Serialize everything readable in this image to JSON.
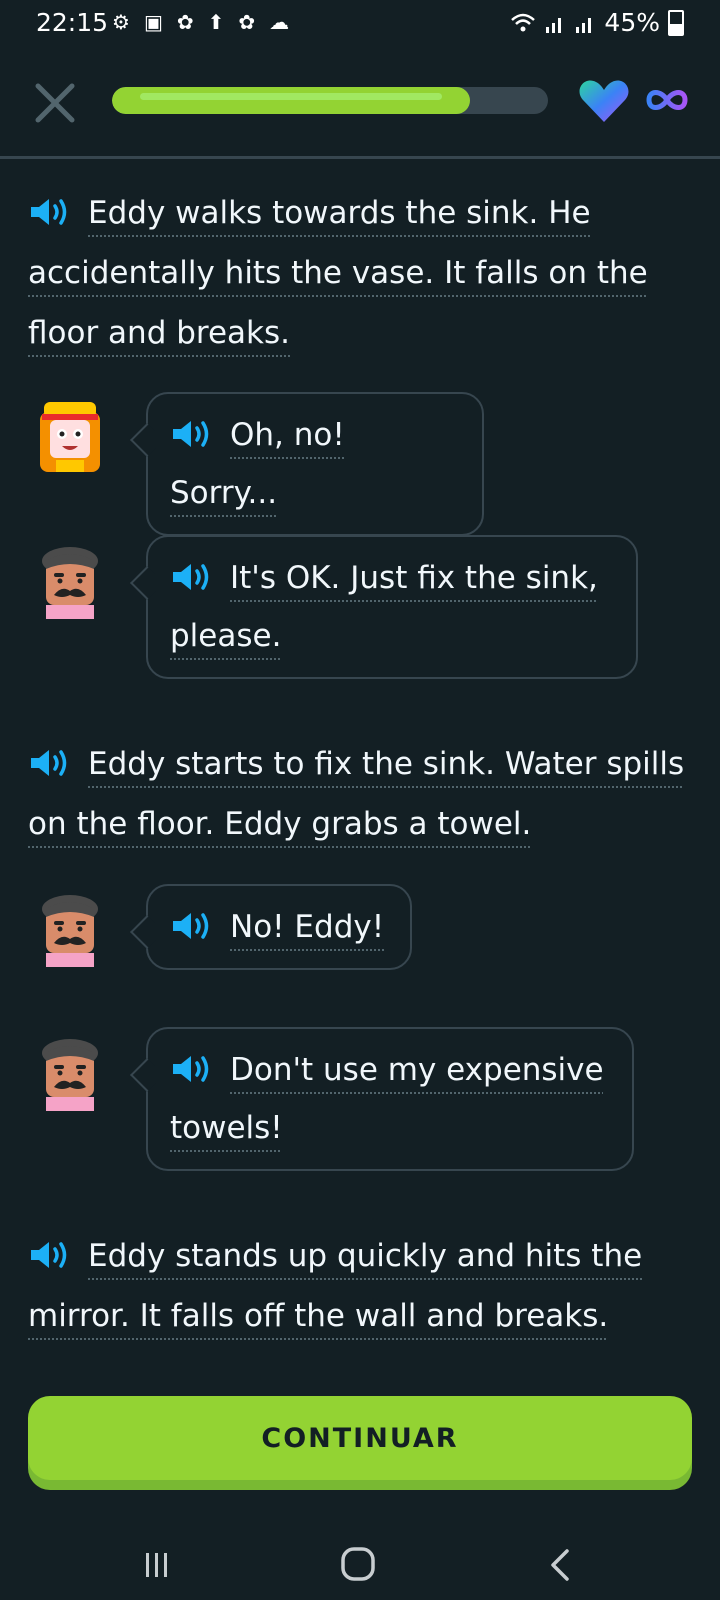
{
  "status_bar": {
    "time": "22:15",
    "battery": "45%"
  },
  "progress": {
    "fraction": 0.82
  },
  "lines": [
    {
      "type": "narration",
      "text": "Eddy walks towards the sink. He accidentally hits the vase. It falls on the floor and breaks."
    },
    {
      "type": "speech",
      "speaker": "eddy",
      "text": "Oh, no! Sorry..."
    },
    {
      "type": "speech",
      "speaker": "owner",
      "text": "It's OK. Just fix the sink, please."
    },
    {
      "type": "narration",
      "text": "Eddy starts to fix the sink. Water spills on the floor. Eddy grabs a towel."
    },
    {
      "type": "speech",
      "speaker": "owner",
      "text": "No! Eddy!"
    },
    {
      "type": "speech",
      "speaker": "owner",
      "text": "Don't use my expensive towels!"
    },
    {
      "type": "narration",
      "text": "Eddy stands up quickly and hits the mirror. It falls off the wall and breaks."
    }
  ],
  "continue_label": "CONTINUAR",
  "colors": {
    "background": "#131f24",
    "accent_green": "#93d333",
    "speaker_blue": "#1cb0f6",
    "border": "#37464f"
  },
  "icons": [
    "close-icon",
    "heart-icon",
    "infinity-icon",
    "speaker-icon",
    "recent-apps-icon",
    "home-icon",
    "back-icon"
  ]
}
